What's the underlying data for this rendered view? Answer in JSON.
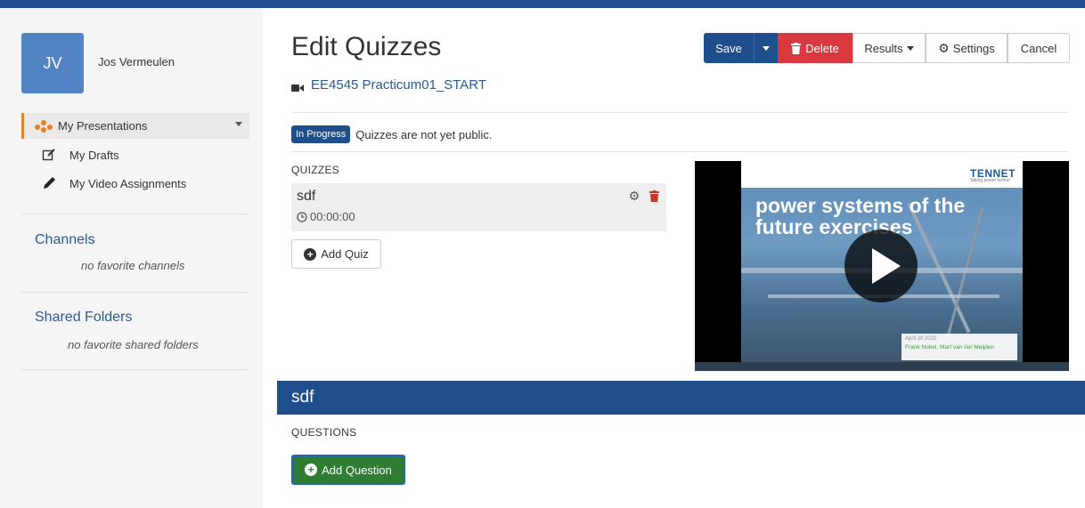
{
  "user": {
    "initials": "JV",
    "name": "Jos Vermeulen"
  },
  "sidebar": {
    "presentations_label": "My Presentations",
    "drafts_label": "My Drafts",
    "assignments_label": "My Video Assignments",
    "channels_title": "Channels",
    "channels_empty": "no favorite channels",
    "folders_title": "Shared Folders",
    "folders_empty": "no favorite shared folders"
  },
  "header": {
    "title": "Edit Quizzes",
    "presentation_name": "EE4545 Practicum01_START"
  },
  "toolbar": {
    "save_label": "Save",
    "delete_label": "Delete",
    "results_label": "Results",
    "settings_label": "Settings",
    "cancel_label": "Cancel"
  },
  "status": {
    "badge": "In Progress",
    "message": "Quizzes are not yet public."
  },
  "quizzes": {
    "heading": "QUIZZES",
    "items": [
      {
        "name": "sdf",
        "time": "00:00:00"
      }
    ],
    "add_label": "Add Quiz"
  },
  "video": {
    "logo": "TENNET",
    "logo_tagline": "Taking power further",
    "slide_title": "power systems of the future exercises",
    "slide_date": "April 30 2020",
    "slide_authors": "Frank Nobel, Mart van der Meijden"
  },
  "selected_quiz": {
    "name": "sdf",
    "questions_heading": "QUESTIONS",
    "add_question_label": "Add Question"
  },
  "colors": {
    "primary": "#1f4e8c",
    "danger": "#d9383d",
    "success": "#2e7d32",
    "accent": "#e67e22"
  }
}
